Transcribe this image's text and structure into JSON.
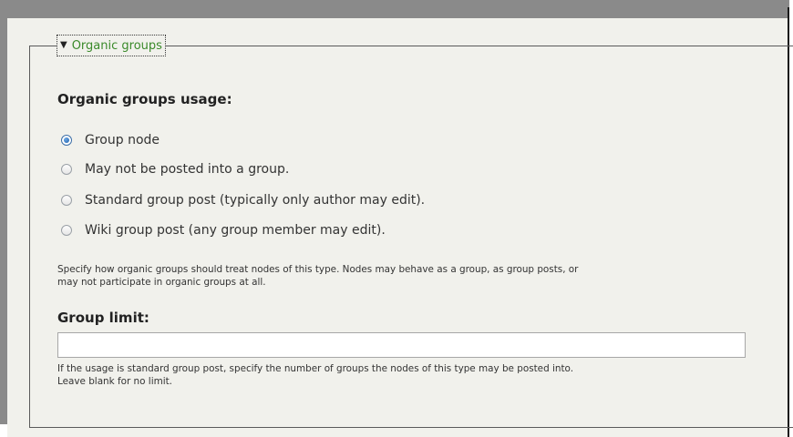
{
  "fieldset": {
    "legend": "Organic groups"
  },
  "usage": {
    "title": "Organic groups usage:",
    "options": [
      {
        "label": "Group node",
        "checked": true
      },
      {
        "label": "May not be posted into a group.",
        "checked": false
      },
      {
        "label": "Standard group post (typically only author may edit).",
        "checked": false
      },
      {
        "label": "Wiki group post (any group member may edit).",
        "checked": false
      }
    ],
    "help_line1": "Specify how organic groups should treat nodes of this type. Nodes may behave as a group, as group posts, or",
    "help_line2": "may not participate in organic groups at all."
  },
  "group_limit": {
    "label": "Group limit:",
    "value": "",
    "help_line1": "If the usage is standard group post, specify the number of groups the nodes of this type may be posted into.",
    "help_line2": "Leave blank for no limit."
  }
}
